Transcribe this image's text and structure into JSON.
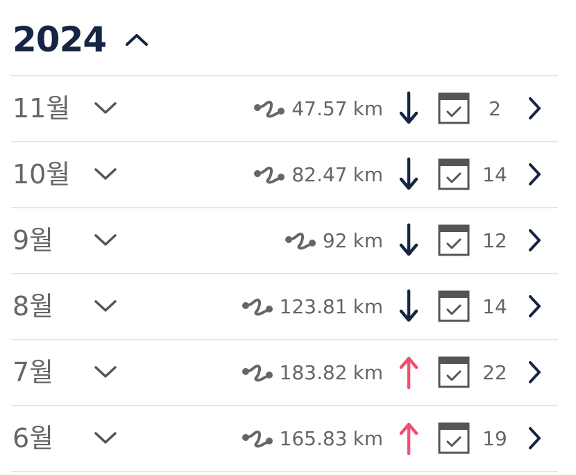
{
  "header": {
    "year": "2024",
    "toggle_icon": "chevron-up-icon"
  },
  "colors": {
    "navy": "#152543",
    "down": "#152543",
    "up": "#f0506e",
    "text": "#666666",
    "divider": "#e6e6e6"
  },
  "distance_unit": "km",
  "months": [
    {
      "label": "11월",
      "distance": "47.57",
      "trend": "down",
      "count": "2"
    },
    {
      "label": "10월",
      "distance": "82.47",
      "trend": "down",
      "count": "14"
    },
    {
      "label": "9월",
      "distance": "92",
      "trend": "down",
      "count": "12"
    },
    {
      "label": "8월",
      "distance": "123.81",
      "trend": "down",
      "count": "14"
    },
    {
      "label": "7월",
      "distance": "183.82",
      "trend": "up",
      "count": "22"
    },
    {
      "label": "6월",
      "distance": "165.83",
      "trend": "up",
      "count": "19"
    }
  ]
}
